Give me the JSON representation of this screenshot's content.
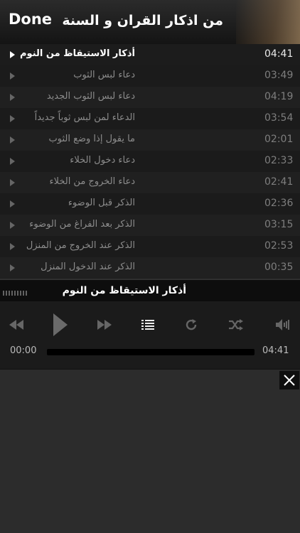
{
  "header": {
    "done_label": "Done",
    "title": "من اذكار القران و السنة"
  },
  "playlist": [
    {
      "title": "أذكار الاستيقاظ من النوم",
      "duration": "04:41",
      "active": true
    },
    {
      "title": "دعاء لبس الثوب",
      "duration": "03:49"
    },
    {
      "title": "دعاء لبس الثوب الجديد",
      "duration": "04:19"
    },
    {
      "title": "الدعاء لمن لبس ثوباً جديداً",
      "duration": "03:54"
    },
    {
      "title": "ما يقول إذا وضع الثوب",
      "duration": "02:01"
    },
    {
      "title": "دعاء دخول الخلاء",
      "duration": "02:33"
    },
    {
      "title": "دعاء الخروج من الخلاء",
      "duration": "02:41"
    },
    {
      "title": "الذكر قبل الوضوء",
      "duration": "02:36"
    },
    {
      "title": "الذكر بعد الفراغ من الوضوء",
      "duration": "03:15"
    },
    {
      "title": "الذكر عند الخروج من المنزل",
      "duration": "02:53"
    },
    {
      "title": "الذكر عند الدخول المنزل",
      "duration": "00:35"
    }
  ],
  "now_playing": {
    "title": "أذكار الاستيقاظ من النوم"
  },
  "player": {
    "current_time": "00:00",
    "total_time": "04:41",
    "progress": 0,
    "controls": [
      "rewind-icon",
      "play-icon",
      "fast-forward-icon",
      "playlist-icon",
      "repeat-icon",
      "shuffle-icon",
      "volume-icon"
    ]
  },
  "colors": {
    "active_text": "#ffffff",
    "inactive_text": "#8c8c8c",
    "control_dim": "#666666"
  }
}
